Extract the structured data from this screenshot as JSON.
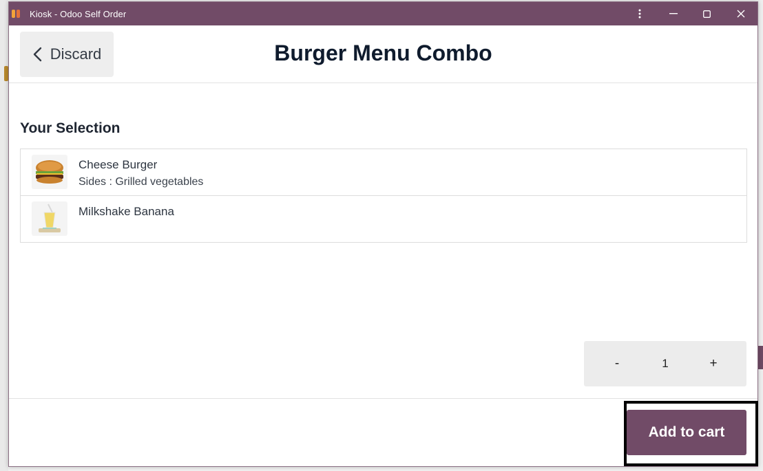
{
  "window": {
    "title": "Kiosk - Odoo Self Order",
    "controls": {
      "menu_icon": "vertical-ellipsis-icon",
      "minimize_icon": "minimize-icon",
      "maximize_icon": "maximize-icon",
      "close_icon": "close-icon"
    }
  },
  "header": {
    "discard_label": "Discard",
    "page_title": "Burger Menu Combo"
  },
  "selection": {
    "heading": "Your Selection",
    "items": [
      {
        "name": "Cheese Burger",
        "detail": "Sides : Grilled vegetables",
        "image": "burger-image"
      },
      {
        "name": "Milkshake Banana",
        "detail": "",
        "image": "milkshake-image"
      }
    ]
  },
  "quantity": {
    "minus_label": "-",
    "value": "1",
    "plus_label": "+"
  },
  "footer": {
    "add_label": "Add to cart"
  },
  "colors": {
    "brand": "#714b67",
    "stepper_bg": "#ececec",
    "discard_bg": "#eeeeee",
    "title_text": "#0f1b2d"
  }
}
